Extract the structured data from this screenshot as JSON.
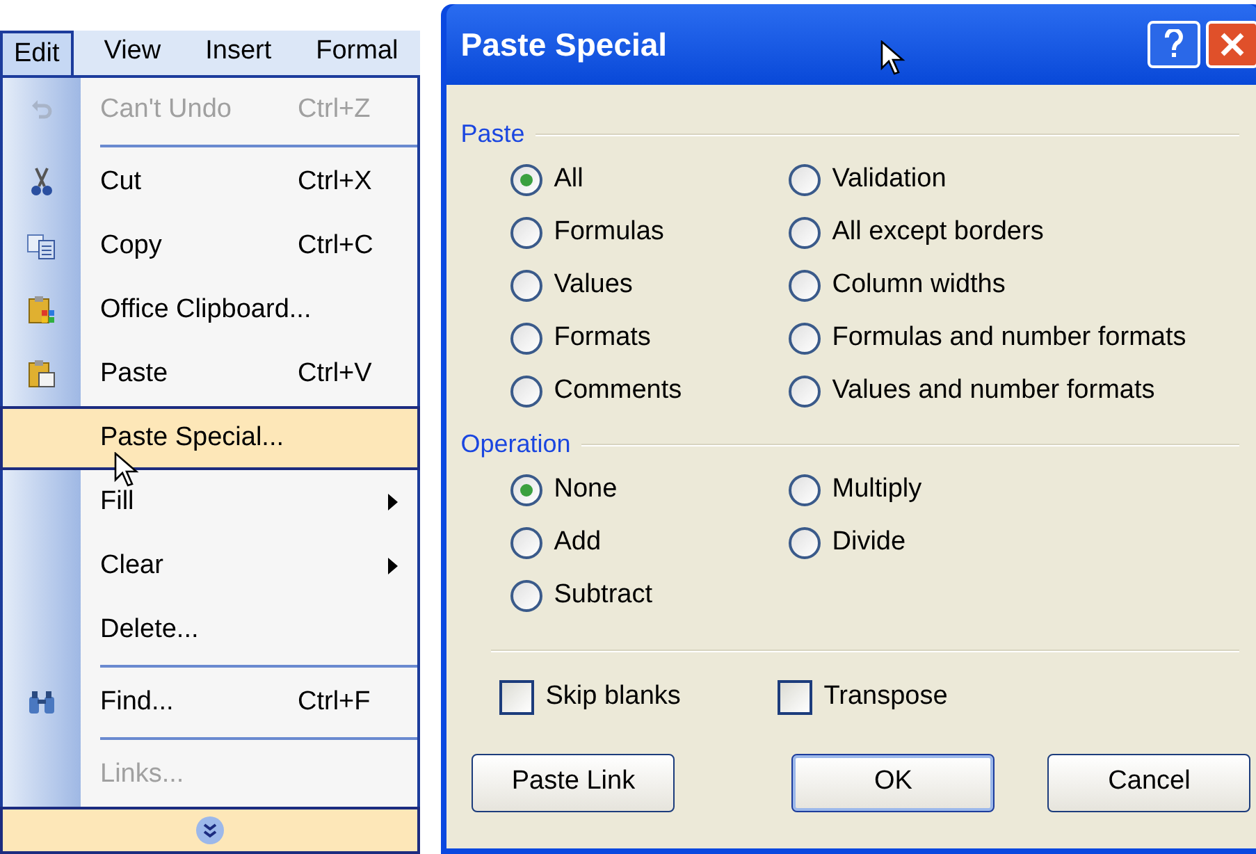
{
  "menubar": [
    {
      "label": "Edit",
      "selected": true
    },
    {
      "label": "View",
      "selected": false
    },
    {
      "label": "Insert",
      "selected": false
    },
    {
      "label": "Formal",
      "selected": false
    }
  ],
  "menu": {
    "items": [
      {
        "kind": "item",
        "label": "Can't Undo",
        "shortcut": "Ctrl+Z",
        "disabled": true,
        "selected": false
      },
      {
        "kind": "separator"
      },
      {
        "kind": "item",
        "label": "Cut",
        "shortcut": "Ctrl+X",
        "disabled": false,
        "selected": false
      },
      {
        "kind": "item",
        "label": "Copy",
        "shortcut": "Ctrl+C",
        "disabled": false,
        "selected": false
      },
      {
        "kind": "item",
        "label": "Office Clipboard...",
        "disabled": false,
        "selected": false
      },
      {
        "kind": "item",
        "label": "Paste",
        "shortcut": "Ctrl+V",
        "disabled": false,
        "selected": false
      },
      {
        "kind": "item",
        "label": "Paste Special...",
        "disabled": false,
        "selected": true
      },
      {
        "kind": "submenu",
        "label": "Fill",
        "disabled": false,
        "selected": false
      },
      {
        "kind": "submenu",
        "label": "Clear",
        "disabled": false,
        "selected": false
      },
      {
        "kind": "item",
        "label": "Delete...",
        "disabled": false,
        "selected": false
      },
      {
        "kind": "separator"
      },
      {
        "kind": "item",
        "label": "Find...",
        "shortcut": "Ctrl+F",
        "disabled": false,
        "selected": false
      },
      {
        "kind": "separator"
      },
      {
        "kind": "item",
        "label": "Links...",
        "disabled": true,
        "selected": false
      }
    ]
  },
  "dialog": {
    "title": "Paste Special",
    "paste": {
      "label": "Paste",
      "options": [
        {
          "label": "All",
          "selected": true
        },
        {
          "label": "Validation",
          "selected": false
        },
        {
          "label": "Formulas",
          "selected": false
        },
        {
          "label": "All except borders",
          "selected": false
        },
        {
          "label": "Values",
          "selected": false
        },
        {
          "label": "Column widths",
          "selected": false
        },
        {
          "label": "Formats",
          "selected": false
        },
        {
          "label": "Formulas and number formats",
          "selected": false
        },
        {
          "label": "Comments",
          "selected": false
        },
        {
          "label": "Values and number formats",
          "selected": false
        }
      ]
    },
    "operation": {
      "label": "Operation",
      "options": [
        {
          "label": "None",
          "selected": true
        },
        {
          "label": "Multiply",
          "selected": false
        },
        {
          "label": "Add",
          "selected": false
        },
        {
          "label": "Divide",
          "selected": false
        },
        {
          "label": "Subtract",
          "selected": false
        }
      ]
    },
    "checkboxes": [
      {
        "label": "Skip blanks",
        "checked": false
      },
      {
        "label": "Transpose",
        "checked": false
      }
    ],
    "buttons": [
      {
        "label": "Paste Link",
        "default": false
      },
      {
        "label": "OK",
        "default": true
      },
      {
        "label": "Cancel",
        "default": false
      }
    ]
  }
}
